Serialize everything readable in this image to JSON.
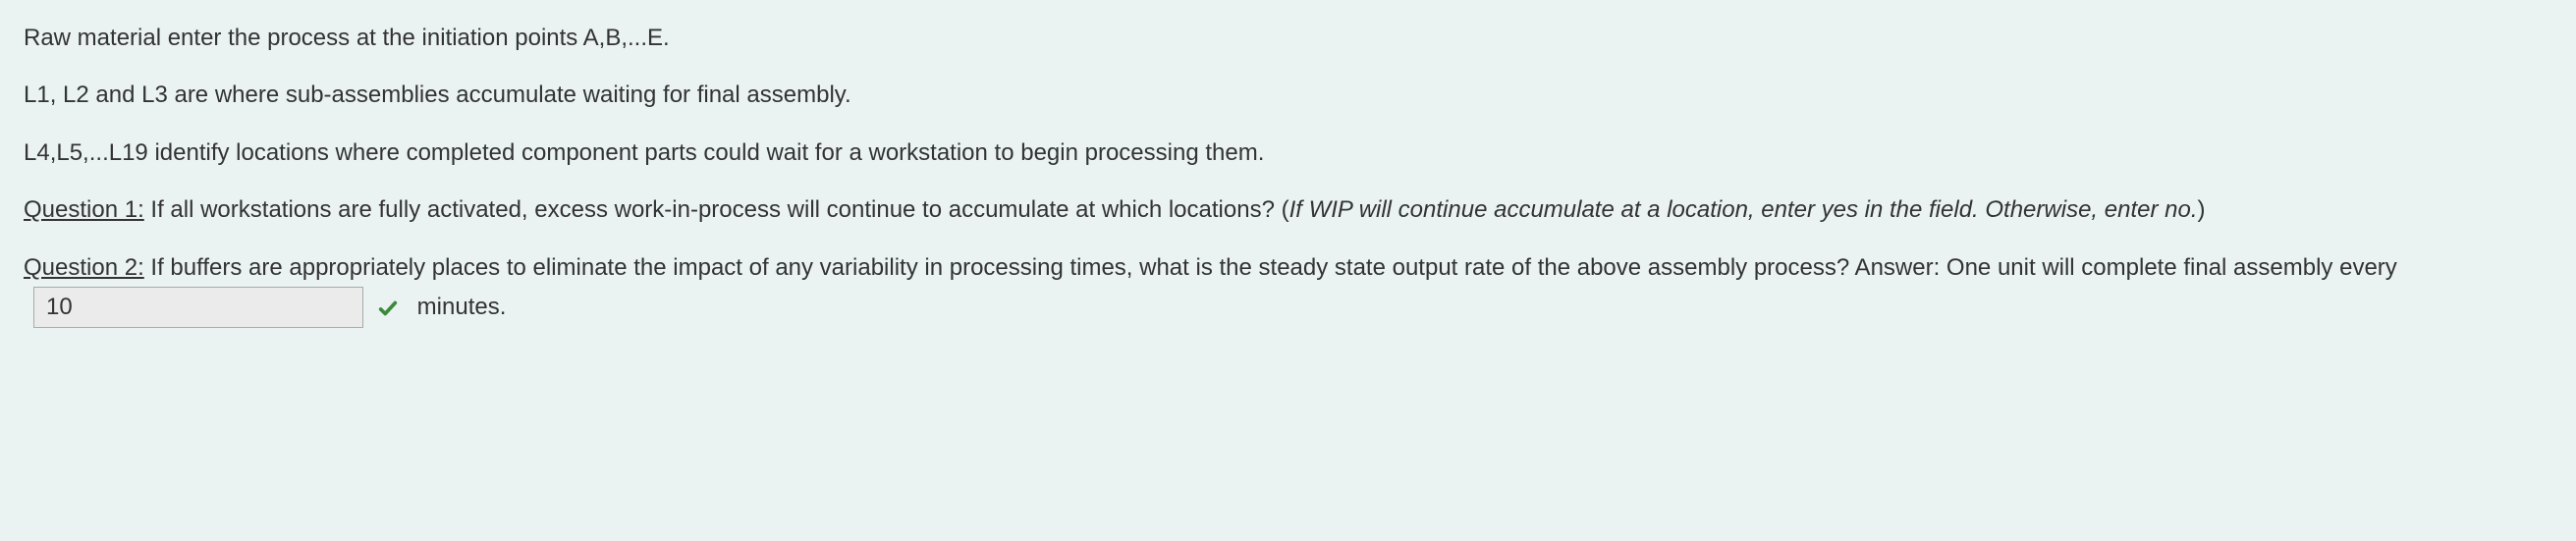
{
  "intro": {
    "line1": "Raw material enter the process at the initiation points A,B,...E.",
    "line2": "L1, L2 and L3 are where sub-assemblies accumulate waiting for final assembly.",
    "line3": "L4,L5,...L19 identify locations where completed component parts could wait for a workstation to begin processing them."
  },
  "question1": {
    "label": "Question 1:",
    "text": " If all workstations are fully activated, excess work-in-process will continue to accumulate at which locations? (",
    "hint": "If WIP will continue accumulate at a location, enter yes in the field. Otherwise, enter no.",
    "tail": ")"
  },
  "question2": {
    "label": "Question 2:",
    "text": " If buffers are appropriately places to eliminate the impact of any variability in processing times, what is the steady state output rate of the above assembly process? Answer: One unit will complete final assembly every ",
    "answer_value": "10",
    "tail": " minutes."
  }
}
